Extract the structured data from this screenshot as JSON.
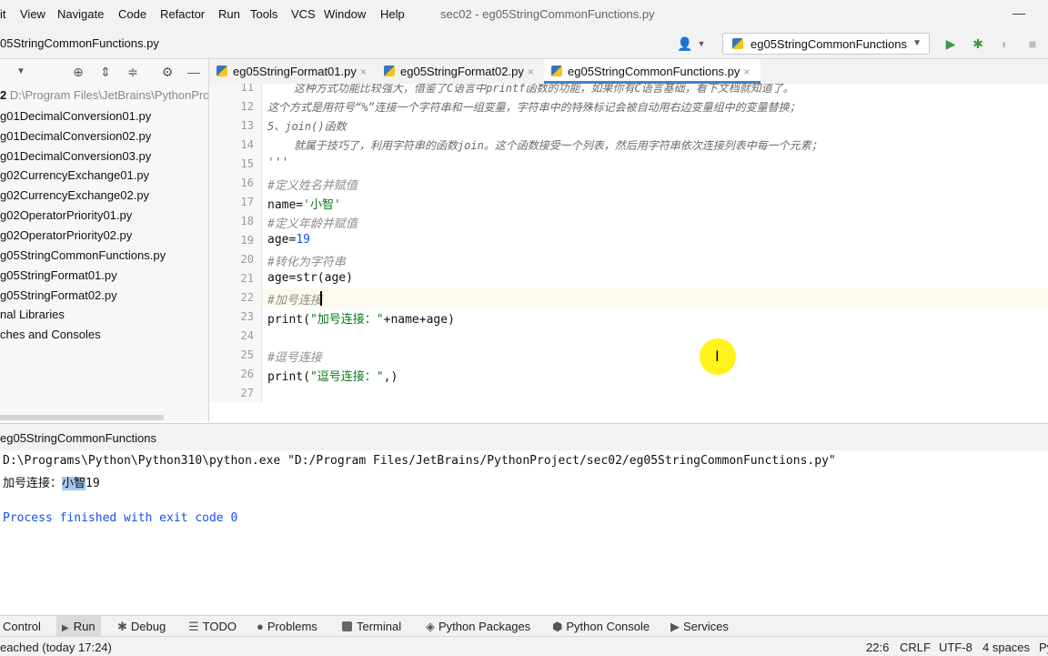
{
  "menu": {
    "items": [
      "it",
      "View",
      "Navigate",
      "Code",
      "Refactor",
      "Run",
      "Tools",
      "VCS",
      "Window",
      "Help"
    ],
    "window_title": "sec02 - eg05StringCommonFunctions.py"
  },
  "navbar": {
    "breadcrumb": "05StringCommonFunctions.py",
    "run_config": "eg05StringCommonFunctions"
  },
  "project": {
    "root_label": "2",
    "root_path": "D:\\Program Files\\JetBrains\\PythonProj",
    "files": [
      "g01DecimalConversion01.py",
      "g01DecimalConversion02.py",
      "g01DecimalConversion03.py",
      "g02CurrencyExchange01.py",
      "g02CurrencyExchange02.py",
      "g02OperatorPriority01.py",
      "g02OperatorPriority02.py",
      "g05StringCommonFunctions.py",
      "g05StringFormat01.py",
      "g05StringFormat02.py",
      "nal Libraries",
      "ches and Consoles"
    ]
  },
  "tabs": [
    {
      "label": "eg05StringFormat01.py",
      "close": "×"
    },
    {
      "label": "eg05StringFormat02.py",
      "close": "×"
    },
    {
      "label": "eg05StringCommonFunctions.py",
      "close": "×"
    }
  ],
  "editor": {
    "line_numbers": [
      "11",
      "12",
      "13",
      "14",
      "15",
      "16",
      "17",
      "18",
      "19",
      "20",
      "21",
      "22",
      "23",
      "24",
      "25",
      "26",
      "27"
    ],
    "l11": "    这种方式功能比较强大，借鉴了C语言中printf函数的功能，如果你有C语言基础，看下文档就知道了。",
    "l12": "这个方式是用符号“%”连接一个字符串和一组变量，字符串中的特殊标记会被自动用右边变量组中的变量替换；",
    "l13": "5、join()函数",
    "l14": "    就属于技巧了，利用字符串的函数join。这个函数接受一个列表，然后用字符串依次连接列表中每一个元素；",
    "l15": "'''",
    "l16": "#定义姓名并赋值",
    "l17_a": "name=",
    "l17_b": "'小智'",
    "l18": "#定义年龄并赋值",
    "l19_a": "age=",
    "l19_b": "19",
    "l20": "#转化为字符串",
    "l21": "age=str(age)",
    "l22": "#加号连接",
    "l23_a": "print(",
    "l23_b": "\"加号连接：\"",
    "l23_c": "+name+age)",
    "l25": "#逗号连接",
    "l26_a": "print(",
    "l26_b": "\"逗号连接：\"",
    "l26_c": ",)"
  },
  "run": {
    "title": "eg05StringCommonFunctions",
    "command": "D:\\Programs\\Python\\Python310\\python.exe \"D:/Program Files/JetBrains/PythonProject/sec02/eg05StringCommonFunctions.py\"",
    "output_prefix": "加号连接：",
    "output_selected": "小智",
    "output_rest": "19",
    "exit_message": "Process finished with exit code 0"
  },
  "tool_windows": [
    "Control",
    "Run",
    "Debug",
    "TODO",
    "Problems",
    "Terminal",
    "Python Packages",
    "Python Console",
    "Services"
  ],
  "status": {
    "message": "eached (today 17:24)",
    "position": "22:6",
    "line_sep": "CRLF",
    "encoding": "UTF-8",
    "indent": "4 spaces",
    "interpreter": "Py"
  },
  "colors": {
    "accent": "#4083c9",
    "string": "#067d17",
    "number": "#1750eb",
    "comment": "#8c8c8c",
    "cursor_highlight": "#fff200"
  }
}
